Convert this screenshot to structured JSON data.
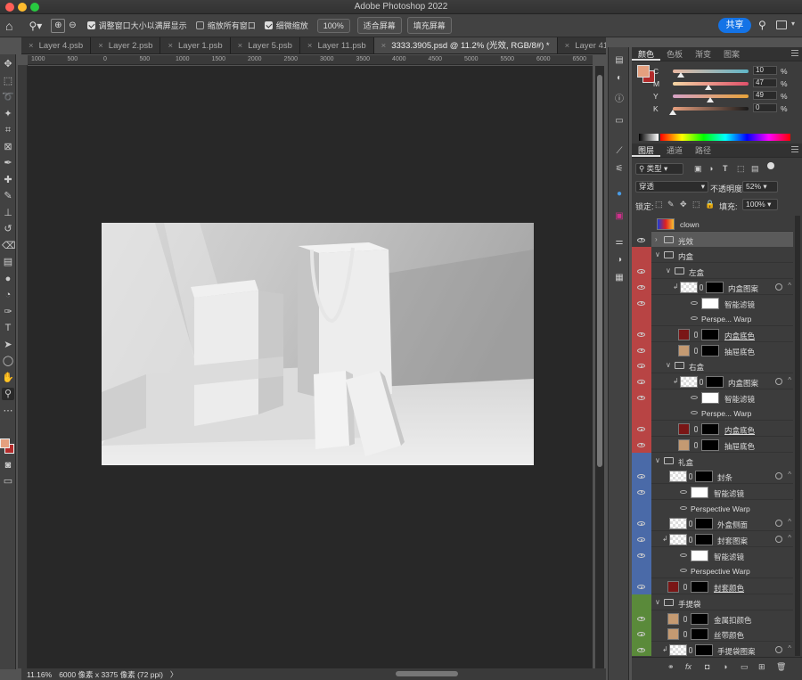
{
  "app": {
    "title": "Adobe Photoshop 2022"
  },
  "options": {
    "resize_windows": "调整窗口大小以满屏显示",
    "zoom_all": "缩放所有窗口",
    "scrubby_zoom": "细微缩放",
    "zoom_value": "100%",
    "fit_screen": "适合屏幕",
    "fill_screen": "填充屏幕",
    "share": "共享"
  },
  "tabs": [
    "Layer 4.psb",
    "Layer 2.psb",
    "Layer 1.psb",
    "Layer 5.psb",
    "Layer 11.psb",
    "3333.3905.psd @ 11.2% (光效, RGB/8#) *",
    "Layer 41."
  ],
  "ruler": [
    "1000",
    "500",
    "0",
    "500",
    "1000",
    "1500",
    "2000",
    "2500",
    "3000",
    "3500",
    "4000",
    "4500",
    "5000",
    "5500",
    "6000",
    "6500"
  ],
  "status": {
    "zoom": "11.16%",
    "doc": "6000 像素 x 3375 像素 (72 ppi)",
    "chev": "〉"
  },
  "color_panel": {
    "tabs": [
      "颜色",
      "色板",
      "渐变",
      "图案"
    ],
    "sliders": [
      {
        "label": "C",
        "value": "10",
        "pct": "%",
        "pos": 0.1,
        "grad": "linear-gradient(90deg,#e9b7a1,#5fb6c8)"
      },
      {
        "label": "M",
        "value": "47",
        "pct": "%",
        "pos": 0.47,
        "grad": "linear-gradient(90deg,#f4d6a4,#e0506a)"
      },
      {
        "label": "Y",
        "value": "49",
        "pct": "%",
        "pos": 0.49,
        "grad": "linear-gradient(90deg,#d6a2c6,#e6a23a)"
      },
      {
        "label": "K",
        "value": "0",
        "pct": "%",
        "pos": 0.0,
        "grad": "linear-gradient(90deg,#e8a07f,#1a1a1a)"
      }
    ],
    "fg_color": "#e5a07f",
    "bg_color": "#b32b2b"
  },
  "layers_panel": {
    "tabs": [
      "图层",
      "通道",
      "路径"
    ],
    "filter_kind": "类型",
    "blend_mode": "穿透",
    "opacity_label": "不透明度:",
    "opacity": "52%",
    "lock_label": "锁定:",
    "fill_label": "填充:",
    "fill": "100%",
    "rows": [
      {
        "name": "clown",
        "kind": "layer",
        "indent": 0,
        "color": "#3c3c3c",
        "eye": false,
        "thumb": "clown"
      },
      {
        "name": "光效",
        "kind": "group",
        "indent": 0,
        "color": "#3c3c3c",
        "eye": true,
        "selected": true,
        "open": false
      },
      {
        "name": "内盒",
        "kind": "group",
        "indent": 0,
        "color": "#b84444",
        "eye": false,
        "open": true
      },
      {
        "name": "左盒",
        "kind": "group",
        "indent": 1,
        "color": "#b84444",
        "eye": true,
        "open": true
      },
      {
        "name": "内盒图案",
        "kind": "smart",
        "indent": 2,
        "color": "#b84444",
        "eye": true,
        "clip": true
      },
      {
        "name": "智能滤镜",
        "kind": "filter",
        "indent": 3,
        "color": "#b84444",
        "eye": true
      },
      {
        "name": "Perspe... Warp",
        "kind": "filteritem",
        "indent": 3,
        "color": "#b84444",
        "eye": false
      },
      {
        "name": "内盒底色",
        "kind": "fill",
        "indent": 2,
        "color": "#b84444",
        "eye": true,
        "swatch": "#7a1616",
        "underline": true
      },
      {
        "name": "抽屉底色",
        "kind": "fill",
        "indent": 2,
        "color": "#b84444",
        "eye": true,
        "swatch": "#c49a72"
      },
      {
        "name": "右盒",
        "kind": "group",
        "indent": 1,
        "color": "#b84444",
        "eye": true,
        "open": true
      },
      {
        "name": "内盒图案",
        "kind": "smart",
        "indent": 2,
        "color": "#b84444",
        "eye": true,
        "clip": true
      },
      {
        "name": "智能滤镜",
        "kind": "filter",
        "indent": 3,
        "color": "#b84444",
        "eye": true
      },
      {
        "name": "Perspe... Warp",
        "kind": "filteritem",
        "indent": 3,
        "color": "#b84444",
        "eye": false
      },
      {
        "name": "内盒底色",
        "kind": "fill",
        "indent": 2,
        "color": "#b84444",
        "eye": true,
        "swatch": "#7a1616",
        "underline": true
      },
      {
        "name": "抽屉底色",
        "kind": "fill",
        "indent": 2,
        "color": "#b84444",
        "eye": true,
        "swatch": "#c49a72"
      },
      {
        "name": "礼盒",
        "kind": "group",
        "indent": 0,
        "color": "#4a6aa8",
        "eye": false,
        "open": true
      },
      {
        "name": "封条",
        "kind": "smart",
        "indent": 1,
        "color": "#4a6aa8",
        "eye": true
      },
      {
        "name": "智能滤镜",
        "kind": "filter",
        "indent": 2,
        "color": "#4a6aa8",
        "eye": true
      },
      {
        "name": "Perspective Warp",
        "kind": "filteritem",
        "indent": 2,
        "color": "#4a6aa8",
        "eye": false
      },
      {
        "name": "外盒侧面",
        "kind": "smart",
        "indent": 1,
        "color": "#4a6aa8",
        "eye": true
      },
      {
        "name": "封套图案",
        "kind": "smart",
        "indent": 1,
        "color": "#4a6aa8",
        "eye": true,
        "clip": true
      },
      {
        "name": "智能滤镜",
        "kind": "filter",
        "indent": 2,
        "color": "#4a6aa8",
        "eye": true
      },
      {
        "name": "Perspective Warp",
        "kind": "filteritem",
        "indent": 2,
        "color": "#4a6aa8",
        "eye": false
      },
      {
        "name": "封套颜色",
        "kind": "fill",
        "indent": 1,
        "color": "#4a6aa8",
        "eye": true,
        "swatch": "#7a1616",
        "underline": true
      },
      {
        "name": "手提袋",
        "kind": "group",
        "indent": 0,
        "color": "#5a8a3a",
        "eye": false,
        "open": true
      },
      {
        "name": "金属扣颜色",
        "kind": "fill",
        "indent": 1,
        "color": "#5a8a3a",
        "eye": true,
        "swatch": "#c49a72"
      },
      {
        "name": "丝带颜色",
        "kind": "fill",
        "indent": 1,
        "color": "#5a8a3a",
        "eye": true,
        "swatch": "#c49a72"
      },
      {
        "name": "手提袋图案",
        "kind": "smart",
        "indent": 1,
        "color": "#5a8a3a",
        "eye": true,
        "clip": true
      }
    ],
    "footer_fx": "fx"
  }
}
